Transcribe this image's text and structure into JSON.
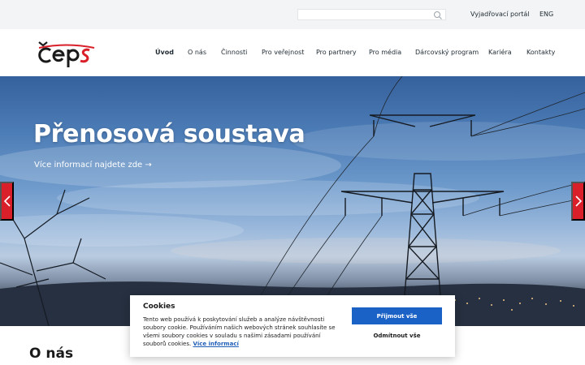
{
  "header": {
    "search": {
      "placeholder": "",
      "value": ""
    },
    "links": [
      {
        "label": "Vyjadřovací portál"
      },
      {
        "label": "ENG"
      }
    ]
  },
  "brand": {
    "logo_text": "čeps",
    "colors": {
      "primary": "#1a1a1a",
      "accent": "#d9202a"
    }
  },
  "nav": {
    "items": [
      {
        "label": "Úvod",
        "active": true
      },
      {
        "label": "O nás"
      },
      {
        "label": "Činnosti"
      },
      {
        "label": "Pro veřejnost"
      },
      {
        "label": "Pro partnery"
      },
      {
        "label": "Pro média"
      },
      {
        "label": "Dárcovský program"
      },
      {
        "label": "Kariéra"
      },
      {
        "label": "Kontakty"
      }
    ]
  },
  "hero": {
    "title": "Přenosová soustava",
    "link": "Více informací najdete zde →",
    "prev_icon": "chevron-left-icon",
    "next_icon": "chevron-right-icon"
  },
  "section": {
    "title": "O nás"
  },
  "cookies": {
    "title": "Cookies",
    "text": "Tento web používá k poskytování služeb a analýze návštěvnosti soubory cookie. Používáním našich webových stránek souhlasíte se všemi soubory cookies v souladu s našimi zásadami používání souborů cookies.",
    "more_link": "Více informací",
    "accept_label": "Přijmout vše",
    "reject_label": "Odmítnout vše",
    "accept_color": "#1b62c6"
  }
}
